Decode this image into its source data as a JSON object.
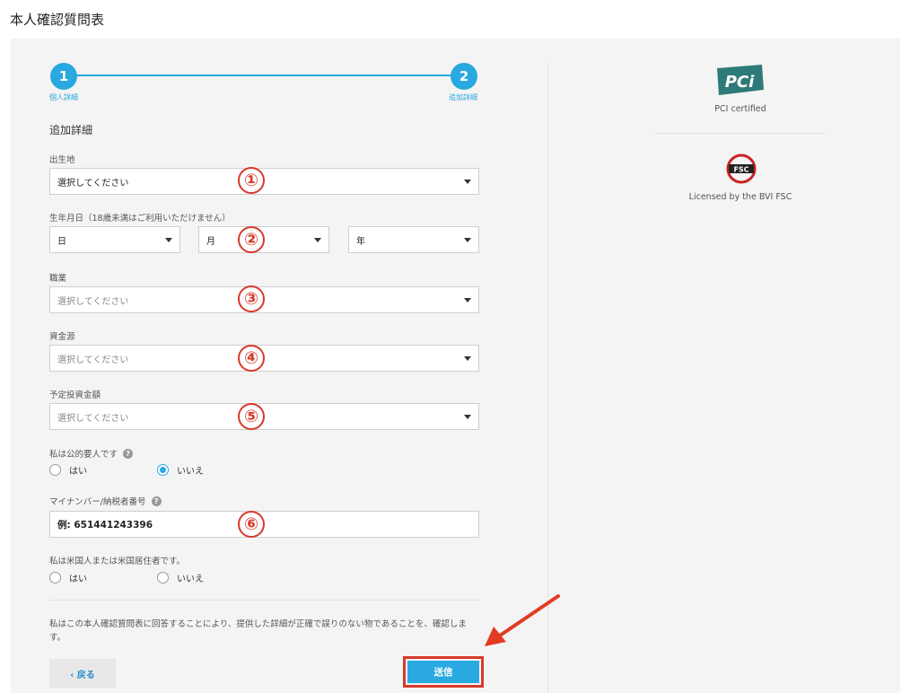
{
  "page_title": "本人確認質問表",
  "stepper": {
    "steps": [
      {
        "number": "1",
        "label": "個人詳細"
      },
      {
        "number": "2",
        "label": "追加詳細"
      }
    ]
  },
  "section_title": "追加詳細",
  "fields": {
    "birthplace": {
      "label": "出生地",
      "value": "選択してください",
      "marker": "①"
    },
    "birthdate": {
      "label": "生年月日（18歳未満はご利用いただけません）",
      "day": "日",
      "month": "月",
      "year": "年",
      "marker": "②"
    },
    "occupation": {
      "label": "職業",
      "value": "選択してください",
      "marker": "③"
    },
    "source_of_funds": {
      "label": "資金源",
      "value": "選択してください",
      "marker": "④"
    },
    "planned_investment": {
      "label": "予定投資金額",
      "value": "選択してください",
      "marker": "⑤"
    },
    "pep": {
      "label": "私は公的要人です",
      "help": "?",
      "options": [
        "はい",
        "いいえ"
      ],
      "selected": "いいえ"
    },
    "tax_id": {
      "label": "マイナンバー/納税者番号",
      "help": "?",
      "placeholder": "例: 651441243396",
      "marker": "⑥"
    },
    "us_person": {
      "label": "私は米国人または米国居住者です。",
      "options": [
        "はい",
        "いいえ"
      ],
      "selected": ""
    }
  },
  "consent_text": "私はこの本人確認質問表に回答することにより、提供した詳細が正確で誤りのない物であることを、確認します。",
  "buttons": {
    "back": "‹ 戻る",
    "submit": "送信"
  },
  "right_panel": {
    "pci_logo_text": "PCi",
    "pci_caption": "PCI certified",
    "fsc_logo_text": "FSC",
    "fsc_caption": "Licensed by the BVI FSC"
  },
  "colors": {
    "accent": "#29a9df",
    "annotation": "#d83a2a"
  }
}
